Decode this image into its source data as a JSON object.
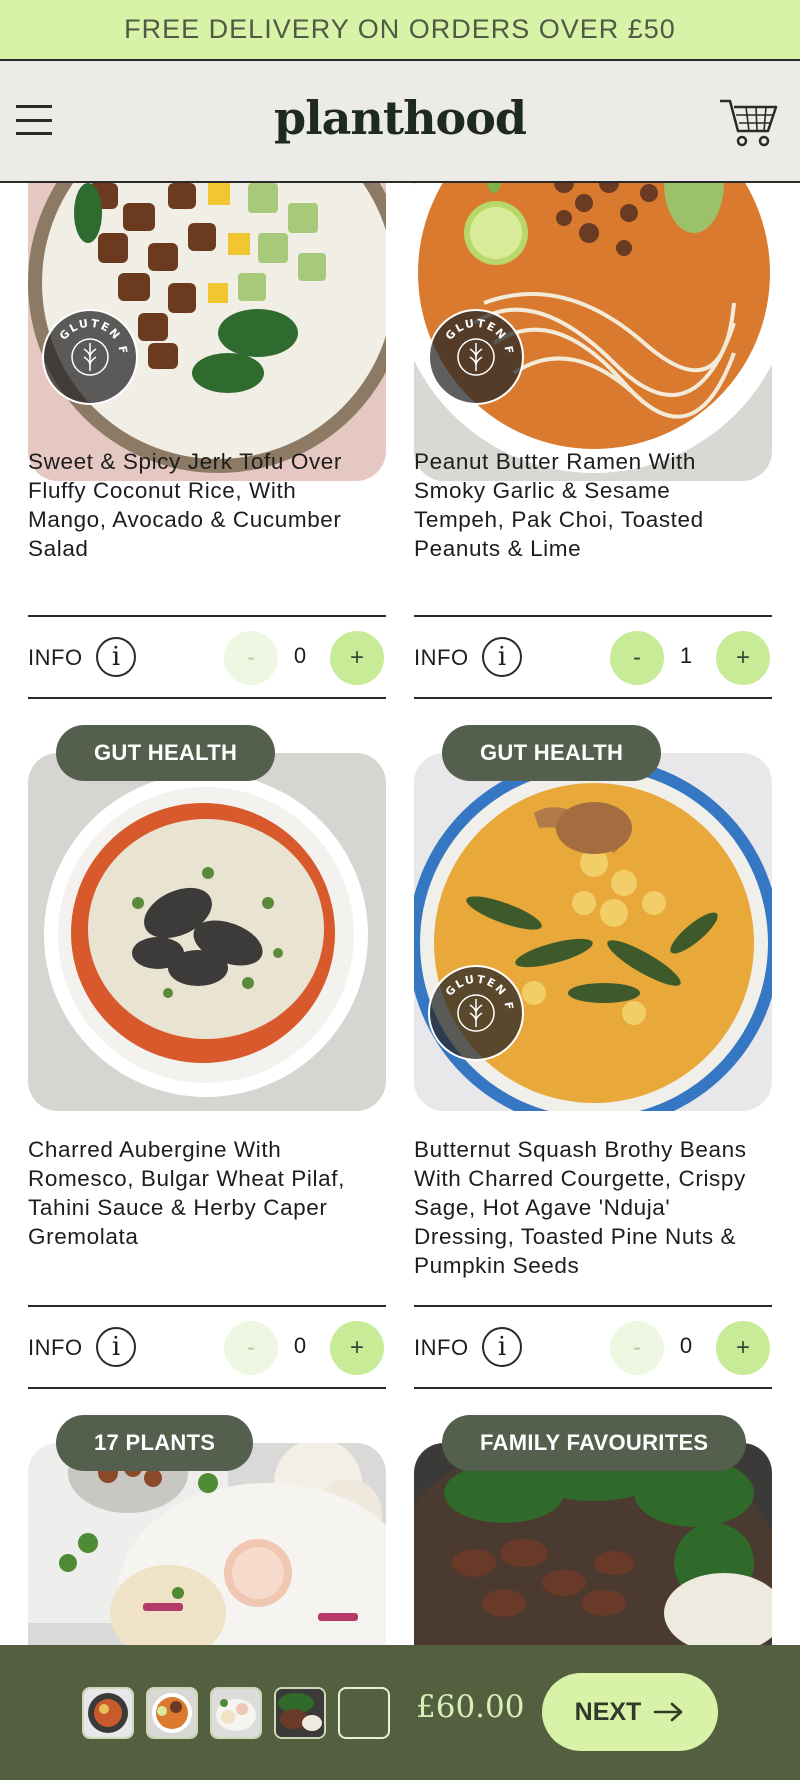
{
  "promo": {
    "text": "FREE DELIVERY ON ORDERS OVER £50"
  },
  "header": {
    "logo": "planthood",
    "menu_icon": "hamburger-menu-icon",
    "cart_icon": "shopping-cart-icon"
  },
  "colors": {
    "accent": "#c8eb98",
    "promo_bg": "#d8f3a8",
    "tag_bg": "#545f4d",
    "bottom_bar": "#535f3e"
  },
  "meals": [
    {
      "title_lines": [
        "Sweet & Spicy Jerk Tofu Over",
        "Fluffy Coconut Rice, With",
        "Mango, Avocado & Cucumber",
        "Salad"
      ],
      "badge": "GLUTEN FREE",
      "info_label": "INFO",
      "minus": "-",
      "plus": "+",
      "qty": "0"
    },
    {
      "title_lines": [
        "Peanut Butter Ramen With",
        "Smoky Garlic & Sesame",
        "Tempeh, Pak Choi, Toasted",
        "Peanuts & Lime"
      ],
      "badge": "GLUTEN FREE",
      "info_label": "INFO",
      "minus": "-",
      "plus": "+",
      "qty": "1"
    },
    {
      "tag": "GUT HEALTH",
      "title_lines": [
        "Charred Aubergine With",
        "Romesco, Bulgar Wheat Pilaf,",
        "Tahini Sauce & Herby Caper",
        "Gremolata"
      ],
      "info_label": "INFO",
      "minus": "-",
      "plus": "+",
      "qty": "0"
    },
    {
      "tag": "GUT HEALTH",
      "title_lines": [
        "Butternut Squash Brothy Beans",
        "With Charred Courgette, Crispy",
        "Sage, Hot Agave 'Nduja'",
        "Dressing, Toasted Pine Nuts &",
        "Pumpkin Seeds"
      ],
      "badge": "GLUTEN FREE",
      "info_label": "INFO",
      "minus": "-",
      "plus": "+",
      "qty": "0"
    },
    {
      "tag": "17 PLANTS"
    },
    {
      "tag": "FAMILY FAVOURITES"
    }
  ],
  "basket": {
    "total": "£60.00",
    "next_label": "NEXT",
    "next_icon": "arrow-right-icon"
  }
}
